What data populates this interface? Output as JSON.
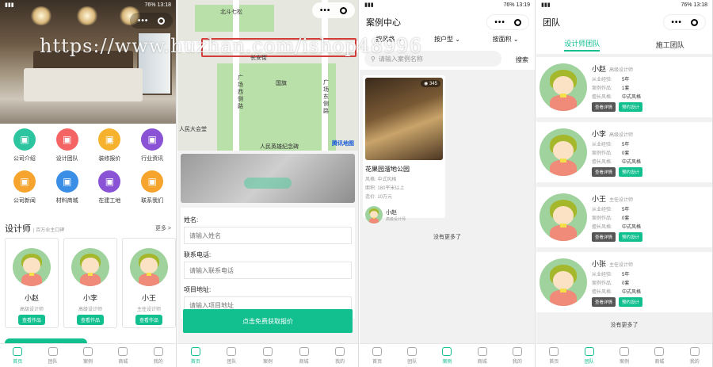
{
  "watermark": "https://www.huzhan.com/ishop48996",
  "panel1": {
    "status_time": "13:18",
    "menu": [
      {
        "label": "公司介绍",
        "icon": "info-icon",
        "color": "#2dc4a0"
      },
      {
        "label": "设计团队",
        "icon": "team-icon",
        "color": "#f46464"
      },
      {
        "label": "装修报价",
        "icon": "quote-icon",
        "color": "#f6b22d"
      },
      {
        "label": "行业资讯",
        "icon": "news-icon",
        "color": "#8a53d6"
      },
      {
        "label": "公司新闻",
        "icon": "company-news-icon",
        "color": "#f6a42d"
      },
      {
        "label": "材料商城",
        "icon": "store-icon",
        "color": "#3b8ee6"
      },
      {
        "label": "在建工地",
        "icon": "site-icon",
        "color": "#8a53d6"
      },
      {
        "label": "联系我们",
        "icon": "contact-icon",
        "color": "#f6a42d"
      }
    ],
    "section_title": "设计师",
    "section_sub": "| 百万业主口碑",
    "more": "更多 >",
    "designers": [
      {
        "name": "小赵",
        "role": "高级设计师",
        "btn": "查看作品"
      },
      {
        "name": "小李",
        "role": "高级设计师",
        "btn": "查看作品"
      },
      {
        "name": "小王",
        "role": "主任设计师",
        "btn": "查看作品"
      }
    ]
  },
  "tabs_home": [
    {
      "label": "首页",
      "active": true
    },
    {
      "label": "团队",
      "active": false
    },
    {
      "label": "案例",
      "active": false
    },
    {
      "label": "商城",
      "active": false
    },
    {
      "label": "我的",
      "active": false
    }
  ],
  "panel2": {
    "map_labels": [
      "北斗七松",
      "广场西侧路",
      "国旗",
      "广场东侧路",
      "人民大会堂",
      "人民英雄纪念碑",
      "长安街",
      "腾讯地图"
    ],
    "form": {
      "name_label": "姓名:",
      "name_placeholder": "请输入姓名",
      "phone_label": "联系电话:",
      "phone_placeholder": "请输入联系电话",
      "addr_label": "项目地址:",
      "addr_placeholder": "请输入项目地址",
      "submit": "点击免费获取报价"
    },
    "tabs": [
      {
        "label": "首页",
        "active": true
      },
      {
        "label": "团队",
        "active": false
      },
      {
        "label": "案例",
        "active": false
      },
      {
        "label": "商城",
        "active": false
      },
      {
        "label": "我的",
        "active": false
      }
    ]
  },
  "panel3": {
    "status_time": "13:19",
    "title": "案例中心",
    "filters": [
      "按风格",
      "按户型",
      "按面积"
    ],
    "search_placeholder": "请输入案例名称",
    "search_btn": "搜索",
    "case": {
      "views": "345",
      "title": "花果园溜地公园",
      "style_k": "风格:",
      "style": "中式风格",
      "area_k": "面积:",
      "area": "180平米以上",
      "price_k": "造价:",
      "price": "10万元",
      "designer": "小赵",
      "designer_role": "高级设计师"
    },
    "no_more": "没有更多了",
    "tabs": [
      {
        "label": "首页",
        "active": false
      },
      {
        "label": "团队",
        "active": false
      },
      {
        "label": "案例",
        "active": true
      },
      {
        "label": "商城",
        "active": false
      },
      {
        "label": "我的",
        "active": false
      }
    ]
  },
  "panel4": {
    "status_time": "13:18",
    "title": "团队",
    "tab_designers": "设计师团队",
    "tab_builders": "施工团队",
    "k_exp": "从业经验:",
    "k_works": "案例作品:",
    "k_style": "擅长风格:",
    "btn_detail": "查看详情",
    "btn_book": "预约设计",
    "members": [
      {
        "name": "小赵",
        "role": "高级设计师",
        "exp": "5年",
        "works": "1套",
        "style": "中式风格"
      },
      {
        "name": "小李",
        "role": "高级设计师",
        "exp": "5年",
        "works": "0套",
        "style": "中式风格"
      },
      {
        "name": "小王",
        "role": "主任设计师",
        "exp": "5年",
        "works": "0套",
        "style": "中式风格"
      },
      {
        "name": "小张",
        "role": "主任设计师",
        "exp": "5年",
        "works": "0套",
        "style": "中式风格"
      }
    ],
    "no_more": "没有更多了",
    "tabs": [
      {
        "label": "首页",
        "active": false
      },
      {
        "label": "团队",
        "active": true
      },
      {
        "label": "案例",
        "active": false
      },
      {
        "label": "商城",
        "active": false
      },
      {
        "label": "我的",
        "active": false
      }
    ]
  },
  "status_battery": "76%"
}
